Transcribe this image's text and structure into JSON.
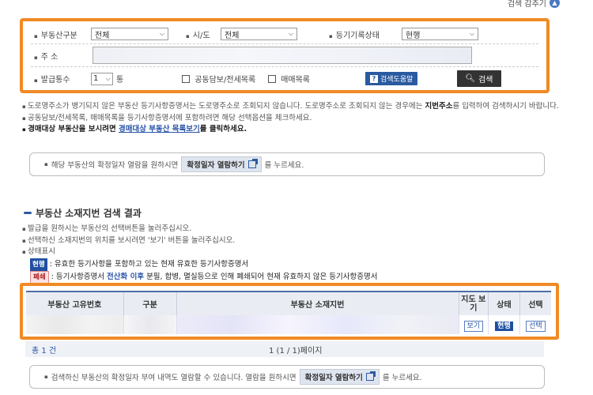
{
  "top_link": {
    "label": "검색 감추기",
    "icon": "chevron-up-icon"
  },
  "search": {
    "type_label": "부동산구분",
    "type_value": "전체",
    "region_label": "시/도",
    "region_value": "전체",
    "status_label": "등기기록상태",
    "status_value": "현행",
    "address_label": "주 소",
    "count_label": "발급통수",
    "count_value": "1",
    "count_unit": "통",
    "joint_label": "공동담보/전세목록",
    "sale_label": "매매목록",
    "help_label": "검색도움말",
    "search_label": "검색"
  },
  "notes": {
    "line1": "도로명주소가 병기되지 않은 부동산 등기사항증명서는 도로명주소로 조회되지 않습니다. 도로명주소로 조회되지 않는 경우에는 ",
    "line1_bold": "지번주소",
    "line1_cont": "를 입력하여 검색하시기 바랍니다.",
    "line2": "공동담보/전세목록, 매매목록을 등기사항증명서에 포함하려면 해당 선택옵션을 체크하세요.",
    "line3_pre": "경매대상 부동산을 보시려면 ",
    "line3_link": "경매대상 부동산 목록보기",
    "line3_post": "를 클릭하세요."
  },
  "info1": {
    "pre": "해당 부동산의 확정일자 열람을 원하시면",
    "button": "확정일자 열람하기",
    "post": "를 누르세요."
  },
  "section_title": "부동산 소재지번 검색 결과",
  "guide": {
    "g1": "발급을 원하시는 부동산의 선택버튼을 눌러주십시오.",
    "g2": "선택하신 소재지번의 위치를 보시려면 '보기' 버튼을 눌러주십시오.",
    "g3": "상태표시",
    "cur_badge": "현행",
    "cur_text": ": 유효한 등기사항을 포함하고 있는 현재 유효한 등기사항증명서",
    "closed_badge": "폐쇄",
    "closed_pre": ": 등기사항증명서 ",
    "closed_hl": "전산화 이후",
    "closed_post": " 분필, 합병, 멸실등으로 인해 폐쇄되어 현재 유효하지 않은 등기사항증명서"
  },
  "table": {
    "headers": [
      "부동산 고유번호",
      "구분",
      "부동산 소재지번",
      "지도 보기",
      "상태",
      "선택"
    ],
    "row": {
      "map": "보기",
      "status": "현행",
      "select": "선택"
    }
  },
  "pager": {
    "total": "총 1 건",
    "page": "1    (1 / 1)페이지"
  },
  "info2": {
    "pre": "검색하신 부동산의 확정일자 부여 내역도 열람할 수 있습니다. 열람을 원하시면",
    "button": "확정일자 열람하기",
    "post": "를 누르세요."
  },
  "colors": {
    "accent": "#f08a24",
    "primary": "#2a5aa0",
    "closed": "#b01e1e"
  }
}
